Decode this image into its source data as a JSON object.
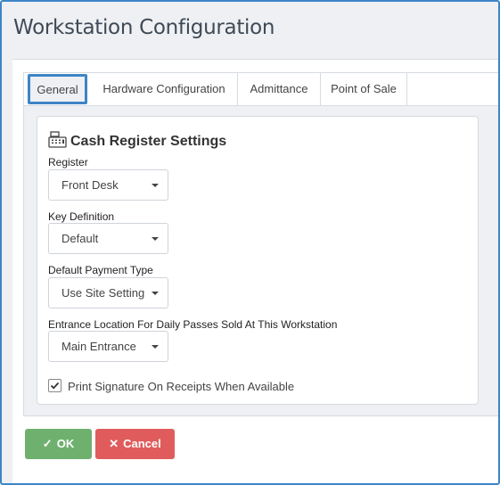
{
  "window": {
    "title": "Workstation Configuration"
  },
  "tabs": [
    {
      "label": "General",
      "active": true
    },
    {
      "label": "Hardware Configuration",
      "active": false
    },
    {
      "label": "Admittance",
      "active": false
    },
    {
      "label": "Point of Sale",
      "active": false
    }
  ],
  "section": {
    "title": "Cash Register Settings",
    "icon": "cash-register-icon"
  },
  "fields": {
    "register": {
      "label": "Register",
      "value": "Front Desk"
    },
    "key_definition": {
      "label": "Key Definition",
      "value": "Default"
    },
    "payment_type": {
      "label": "Default Payment Type",
      "value": "Use Site Setting"
    },
    "entrance_location": {
      "label": "Entrance Location For Daily Passes Sold At This Workstation",
      "value": "Main Entrance"
    }
  },
  "print_signature": {
    "label": "Print Signature On Receipts When Available",
    "checked": true
  },
  "buttons": {
    "ok": "OK",
    "cancel": "Cancel"
  },
  "colors": {
    "accent": "#3d85c6",
    "ok": "#6fb06f",
    "cancel": "#e05c5c"
  }
}
